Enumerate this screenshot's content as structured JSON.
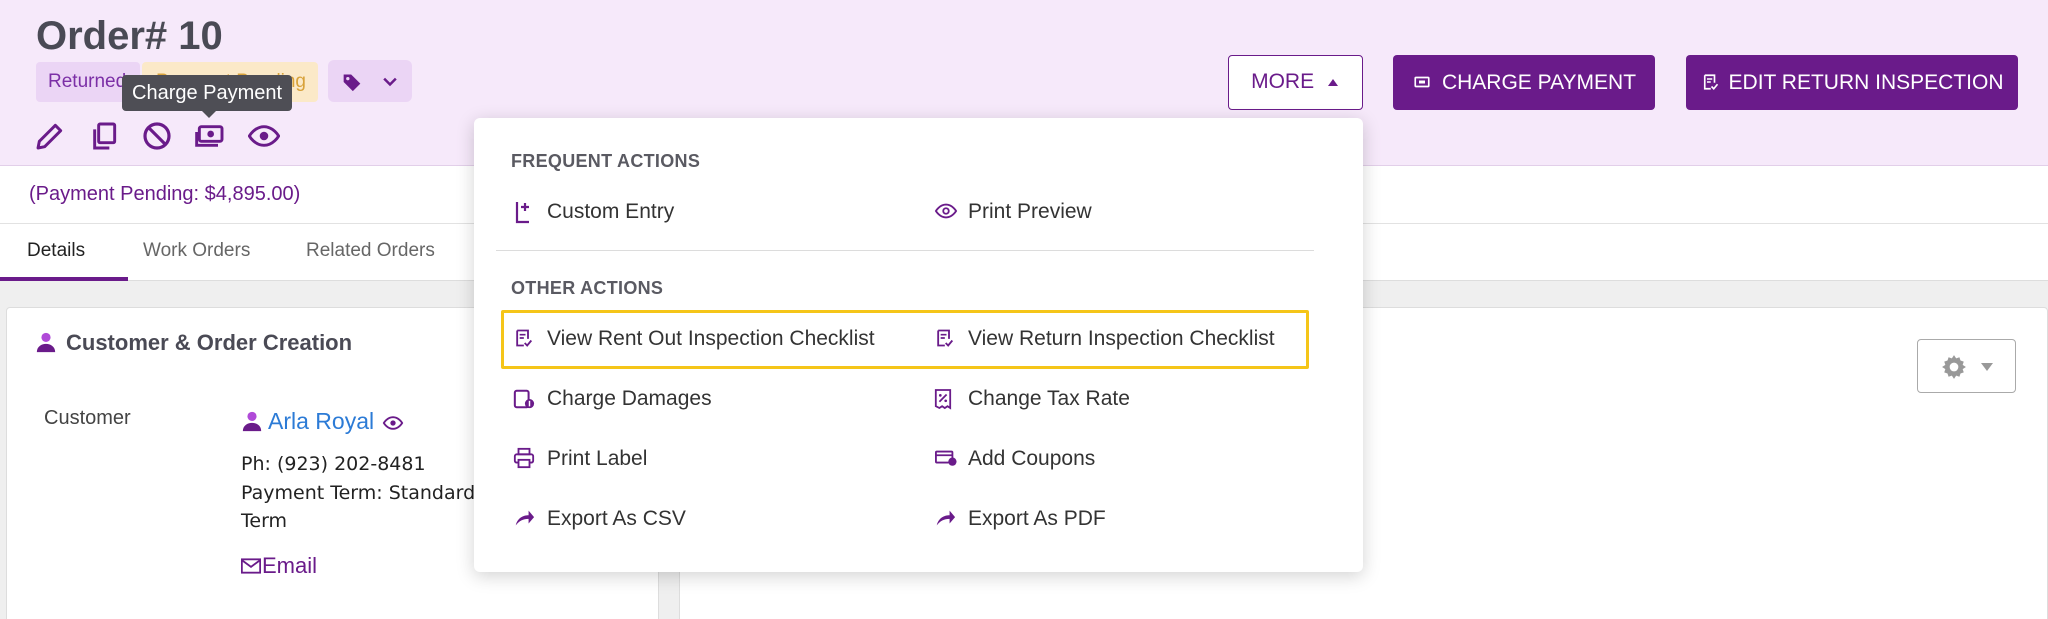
{
  "header": {
    "title": "Order# 10",
    "badge_status": "Returned",
    "badge_payment": "Payment Pending",
    "tooltip": "Charge Payment",
    "buttons": {
      "more": "MORE",
      "charge_payment": "CHARGE PAYMENT",
      "edit_return_inspection": "EDIT RETURN INSPECTION"
    }
  },
  "payment_pending": "(Payment Pending: $4,895.00)",
  "tabs": [
    "Details",
    "Work Orders",
    "Related Orders"
  ],
  "customer_card": {
    "title": "Customer & Order Creation",
    "customer_label": "Customer",
    "customer_name": "Arla Royal",
    "phone": "Ph: (923) 202-8481",
    "payment_term_line1": "Payment Term: Standard",
    "payment_term_line2": "Term",
    "email": "Email"
  },
  "dropdown": {
    "frequent_title": "FREQUENT ACTIONS",
    "frequent": [
      "Custom Entry",
      "Print Preview"
    ],
    "other_title": "OTHER ACTIONS",
    "other": [
      "View Rent Out Inspection Checklist",
      "View Return Inspection Checklist",
      "Charge Damages",
      "Change Tax Rate",
      "Print Label",
      "Add Coupons",
      "Export As CSV",
      "Export As PDF"
    ]
  },
  "colors": {
    "brand": "#6a1b8a",
    "header_bg": "#f6e9fa",
    "highlight": "#f5c518",
    "link": "#2c7bd6"
  }
}
